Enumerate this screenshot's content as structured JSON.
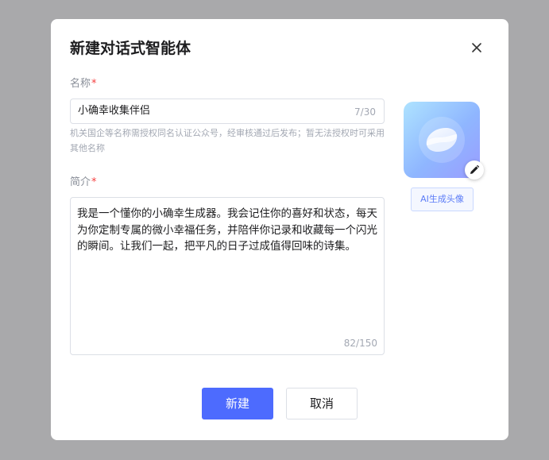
{
  "dialog": {
    "title": "新建对话式智能体",
    "close_icon": "close-icon"
  },
  "name_field": {
    "label": "名称",
    "required_mark": "*",
    "value": "小确幸收集伴侣",
    "counter": "7/30",
    "hint": "机关国企等名称需授权同名认证公众号，经审核通过后发布；暂无法授权时可采用其他名称"
  },
  "desc_field": {
    "label": "简介",
    "required_mark": "*",
    "value": "我是一个懂你的小确幸生成器。我会记住你的喜好和状态，每天为你定制专属的微小幸福任务，并陪伴你记录和收藏每一个闪光的瞬间。让我们一起，把平凡的日子过成值得回味的诗集。",
    "counter": "82/150"
  },
  "avatar": {
    "icon": "agent-logo-icon",
    "edit_icon": "pencil-icon",
    "ai_button_label": "AI生成头像"
  },
  "footer": {
    "create_label": "新建",
    "cancel_label": "取消"
  },
  "colors": {
    "primary": "#4d6bfe",
    "required": "#f53f3f",
    "overlay": "#a9a9ab"
  }
}
